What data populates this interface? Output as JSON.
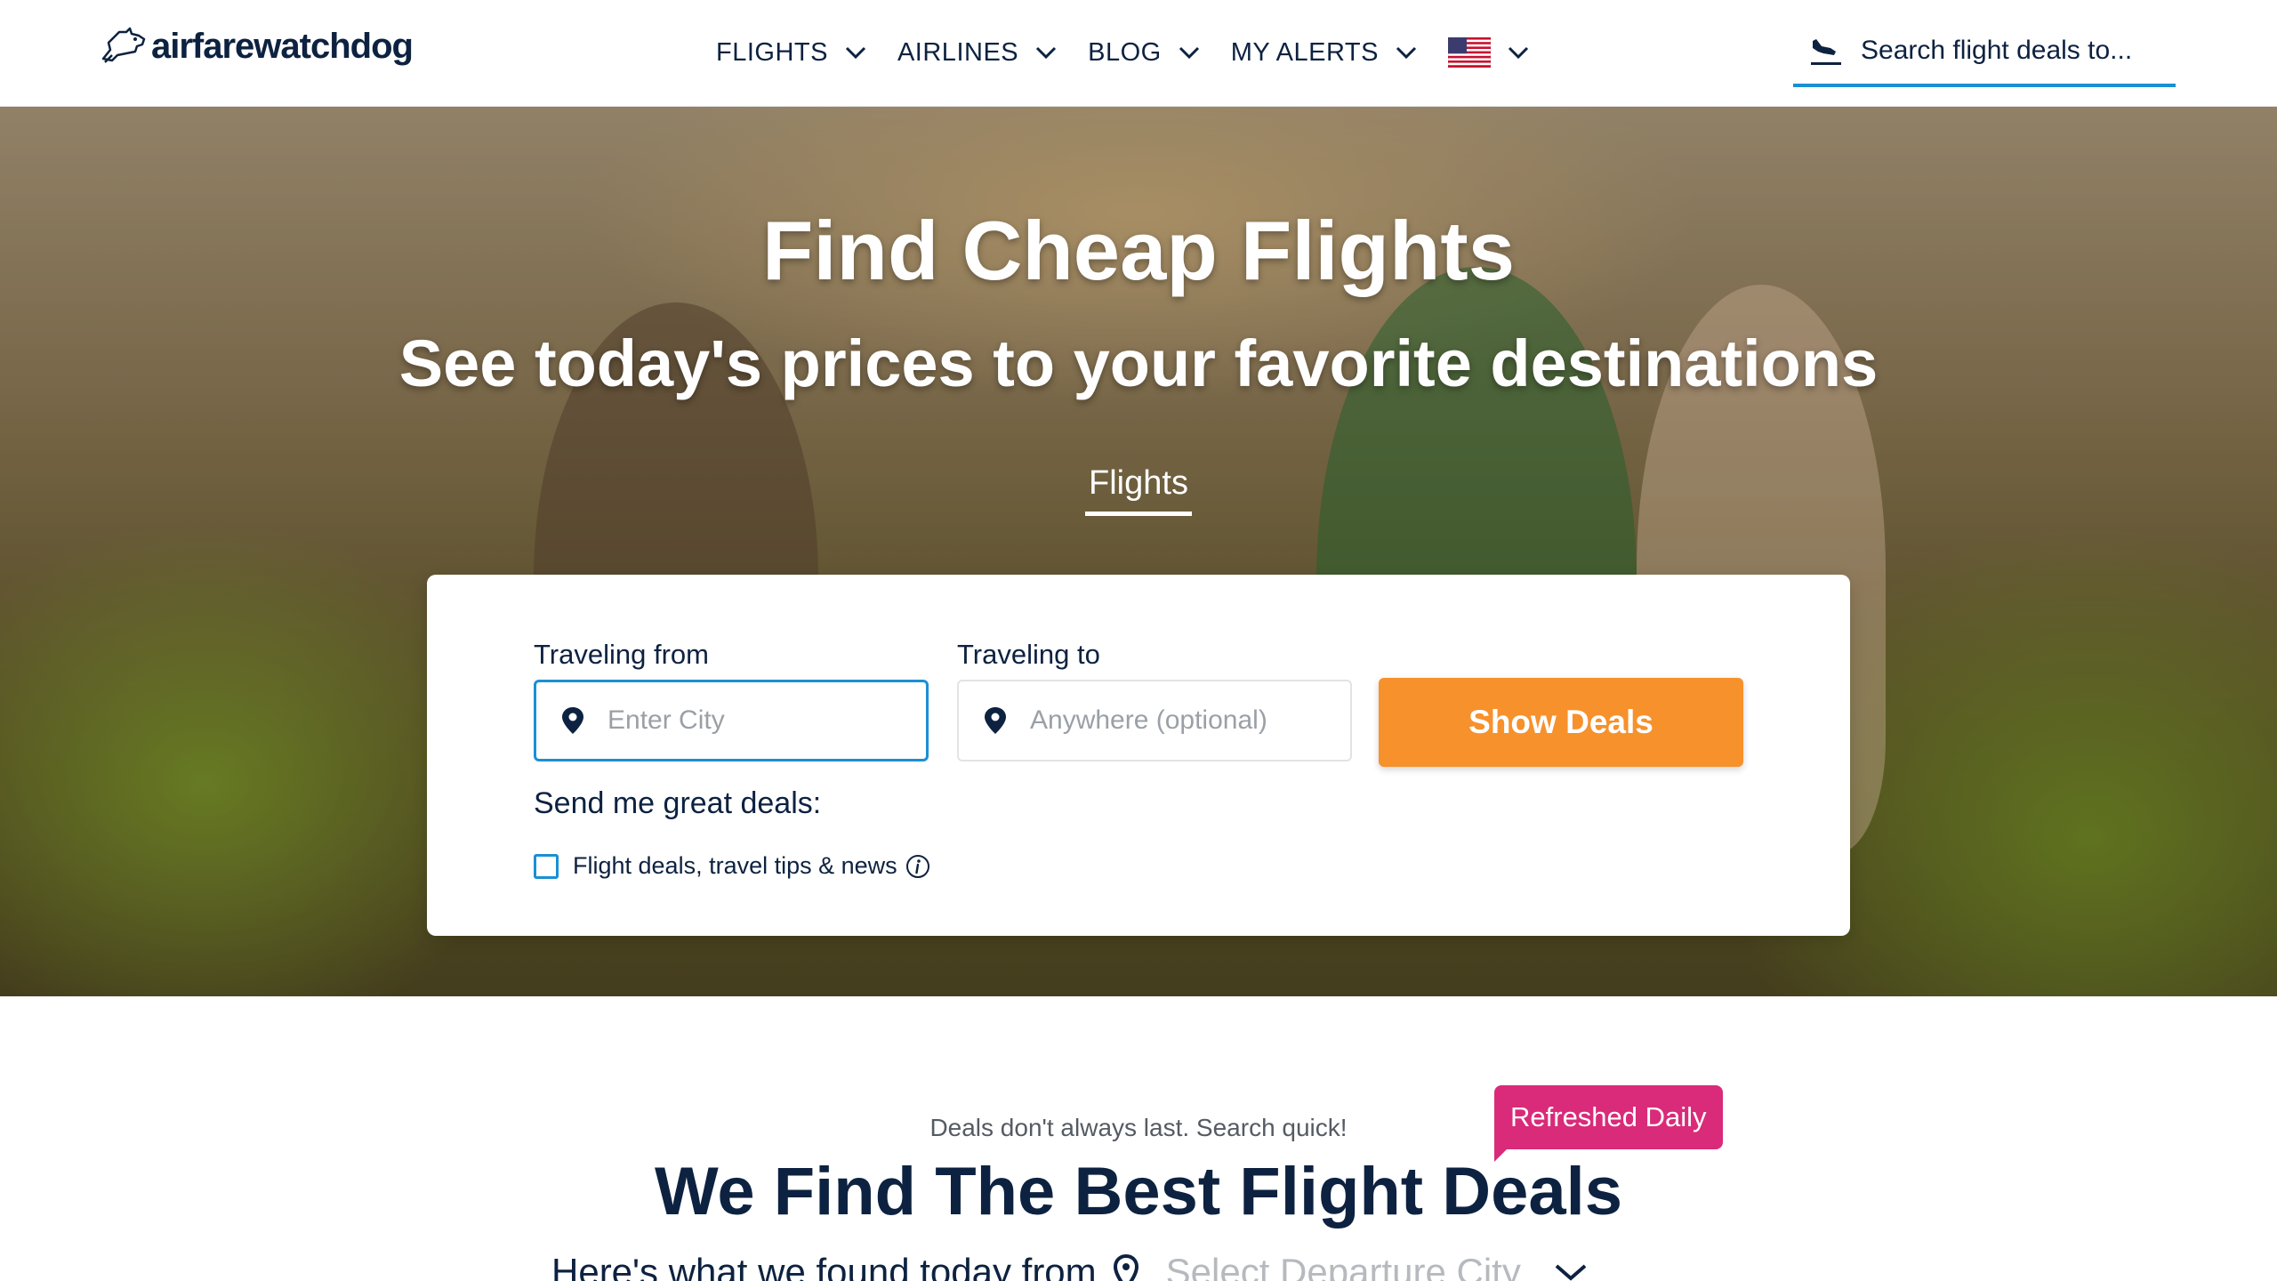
{
  "header": {
    "logo_text": "airfarewatchdog",
    "nav": [
      {
        "label": "FLIGHTS"
      },
      {
        "label": "AIRLINES"
      },
      {
        "label": "BLOG"
      },
      {
        "label": "MY ALERTS"
      }
    ],
    "flag": "us-flag-icon",
    "search_placeholder": "Search flight deals to..."
  },
  "hero": {
    "title": "Find Cheap Flights",
    "subtitle": "See today's prices to your favorite destinations",
    "tab": "Flights"
  },
  "search_card": {
    "from_label": "Traveling from",
    "from_placeholder": "Enter City",
    "to_label": "Traveling to",
    "to_placeholder": "Anywhere (optional)",
    "button_label": "Show Deals",
    "send_label": "Send me great deals:",
    "checkbox_label": "Flight deals, travel tips & news",
    "checkbox_checked": false
  },
  "deals": {
    "tagline": "Deals don't always last. Search quick!",
    "badge": "Refreshed Daily",
    "title": "We Find The Best Flight Deals",
    "subline_prefix": "Here's what we found today from",
    "departure_placeholder": "Select Departure City"
  },
  "colors": {
    "navy": "#0d2240",
    "accent_blue": "#1b8fd4",
    "orange": "#f7912c",
    "pink": "#d92b7a"
  }
}
